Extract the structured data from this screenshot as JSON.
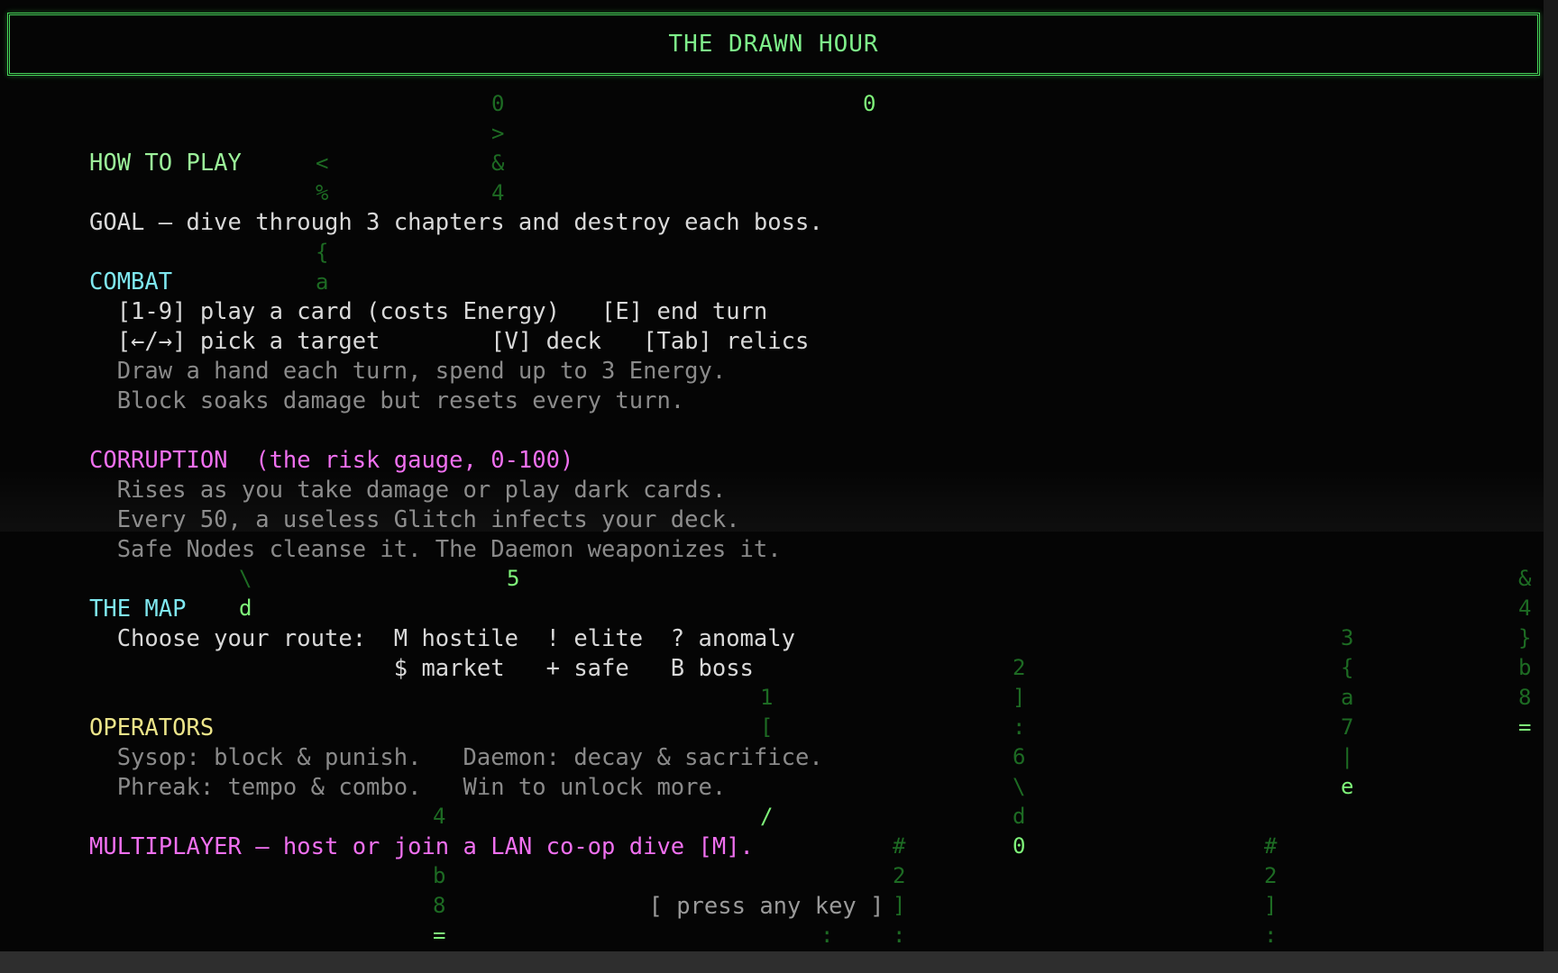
{
  "title": "THE DRAWN HOUR",
  "sections": {
    "how_to_play": "HOW TO PLAY",
    "goal": "GOAL — dive through 3 chapters and destroy each boss.",
    "combat": {
      "heading": "COMBAT",
      "line1": "  [1-9] play a card (costs Energy)   [E] end turn",
      "line2": "  [←/→] pick a target        [V] deck   [Tab] relics",
      "line3": "  Draw a hand each turn, spend up to 3 Energy.",
      "line4": "  Block soaks damage but resets every turn."
    },
    "corruption": {
      "heading": "CORRUPTION  (the risk gauge, 0-100)",
      "line1": "  Rises as you take damage or play dark cards.",
      "line2": "  Every 50, a useless Glitch infects your deck.",
      "line3": "  Safe Nodes cleanse it. The Daemon weaponizes it."
    },
    "map": {
      "heading": "THE MAP",
      "line1": "  Choose your route:  M hostile  ! elite  ? anomaly",
      "line2": "                      $ market   + safe   B boss"
    },
    "operators": {
      "heading": "OPERATORS",
      "line1": "  Sysop: block & punish.   Daemon: decay & sacrifice.",
      "line2": "  Phreak: tempo & combo.   Win to unlock more."
    },
    "multiplayer": "MULTIPLAYER — host or join a LAN co-op dive [M]."
  },
  "prompt": "[ press any key ]",
  "rain": {
    "g1": "0",
    "g2": ">",
    "g3": "&",
    "g4": "4",
    "g5": "<",
    "g6": "%",
    "g7": "{",
    "g8": "a",
    "g9": "0",
    "g10": "5",
    "g11": "\\",
    "g12": "d",
    "g13": "1",
    "g14": "[",
    "g15": "2",
    "g16": "]",
    "g17": ":",
    "g18": "6",
    "g19": "\\",
    "g20": "d",
    "g21": "0",
    "g22": "/",
    "g23": "4",
    "g24": "b",
    "g25": "8",
    "g26": "=",
    "g27": "#",
    "g28": "2",
    "g29": "]",
    "g30": ":",
    "g31": ":",
    "g32": "3",
    "g33": "{",
    "g34": "a",
    "g35": "7",
    "g36": "|",
    "g37": "e",
    "g38": "#",
    "g39": "2",
    "g40": "]",
    "g41": ":",
    "g42": "&",
    "g43": "4",
    "g44": "}",
    "g45": "b",
    "g46": "8",
    "g47": "="
  }
}
